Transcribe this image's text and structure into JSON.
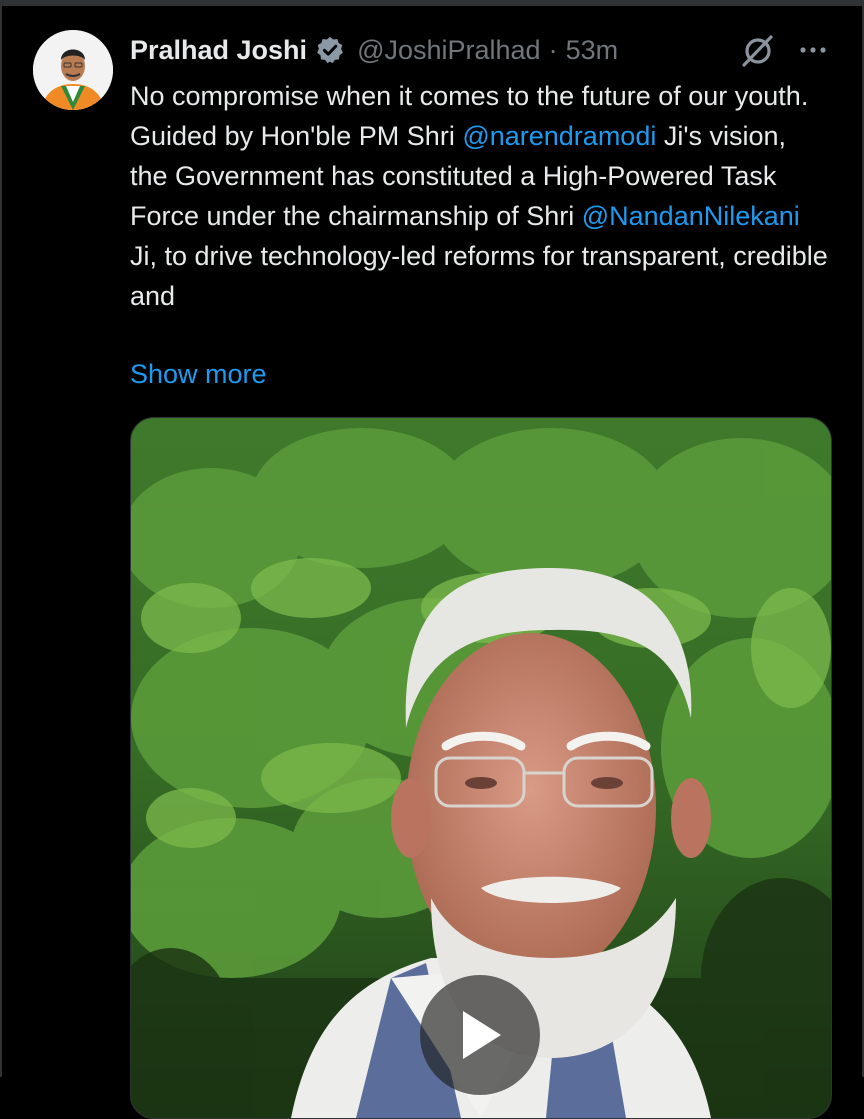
{
  "tweet": {
    "author_name": "Pralhad Joshi",
    "handle": "@JoshiPralhad",
    "separator": "·",
    "time": "53m",
    "line1": "No compromise when it comes to the future of our youth.",
    "line2_pre": "Guided by Hon'ble PM Shri ",
    "mention1": "@narendramodi",
    "line2_mid": " Ji's vision, the Government has constituted a High-Powered Task Force under the chairmanship of Shri ",
    "mention2": "@NandanNilekani",
    "line2_post": " Ji, to drive technology-led reforms for transparent, credible and",
    "show_more": "Show more"
  },
  "icons": {
    "verified": "verified-badge-icon",
    "grok": "grok-icon",
    "more": "more-options-icon",
    "play": "play-icon"
  },
  "colors": {
    "background": "#000000",
    "text": "#e7e9ea",
    "secondary": "#71767b",
    "link": "#1d9bf0"
  }
}
